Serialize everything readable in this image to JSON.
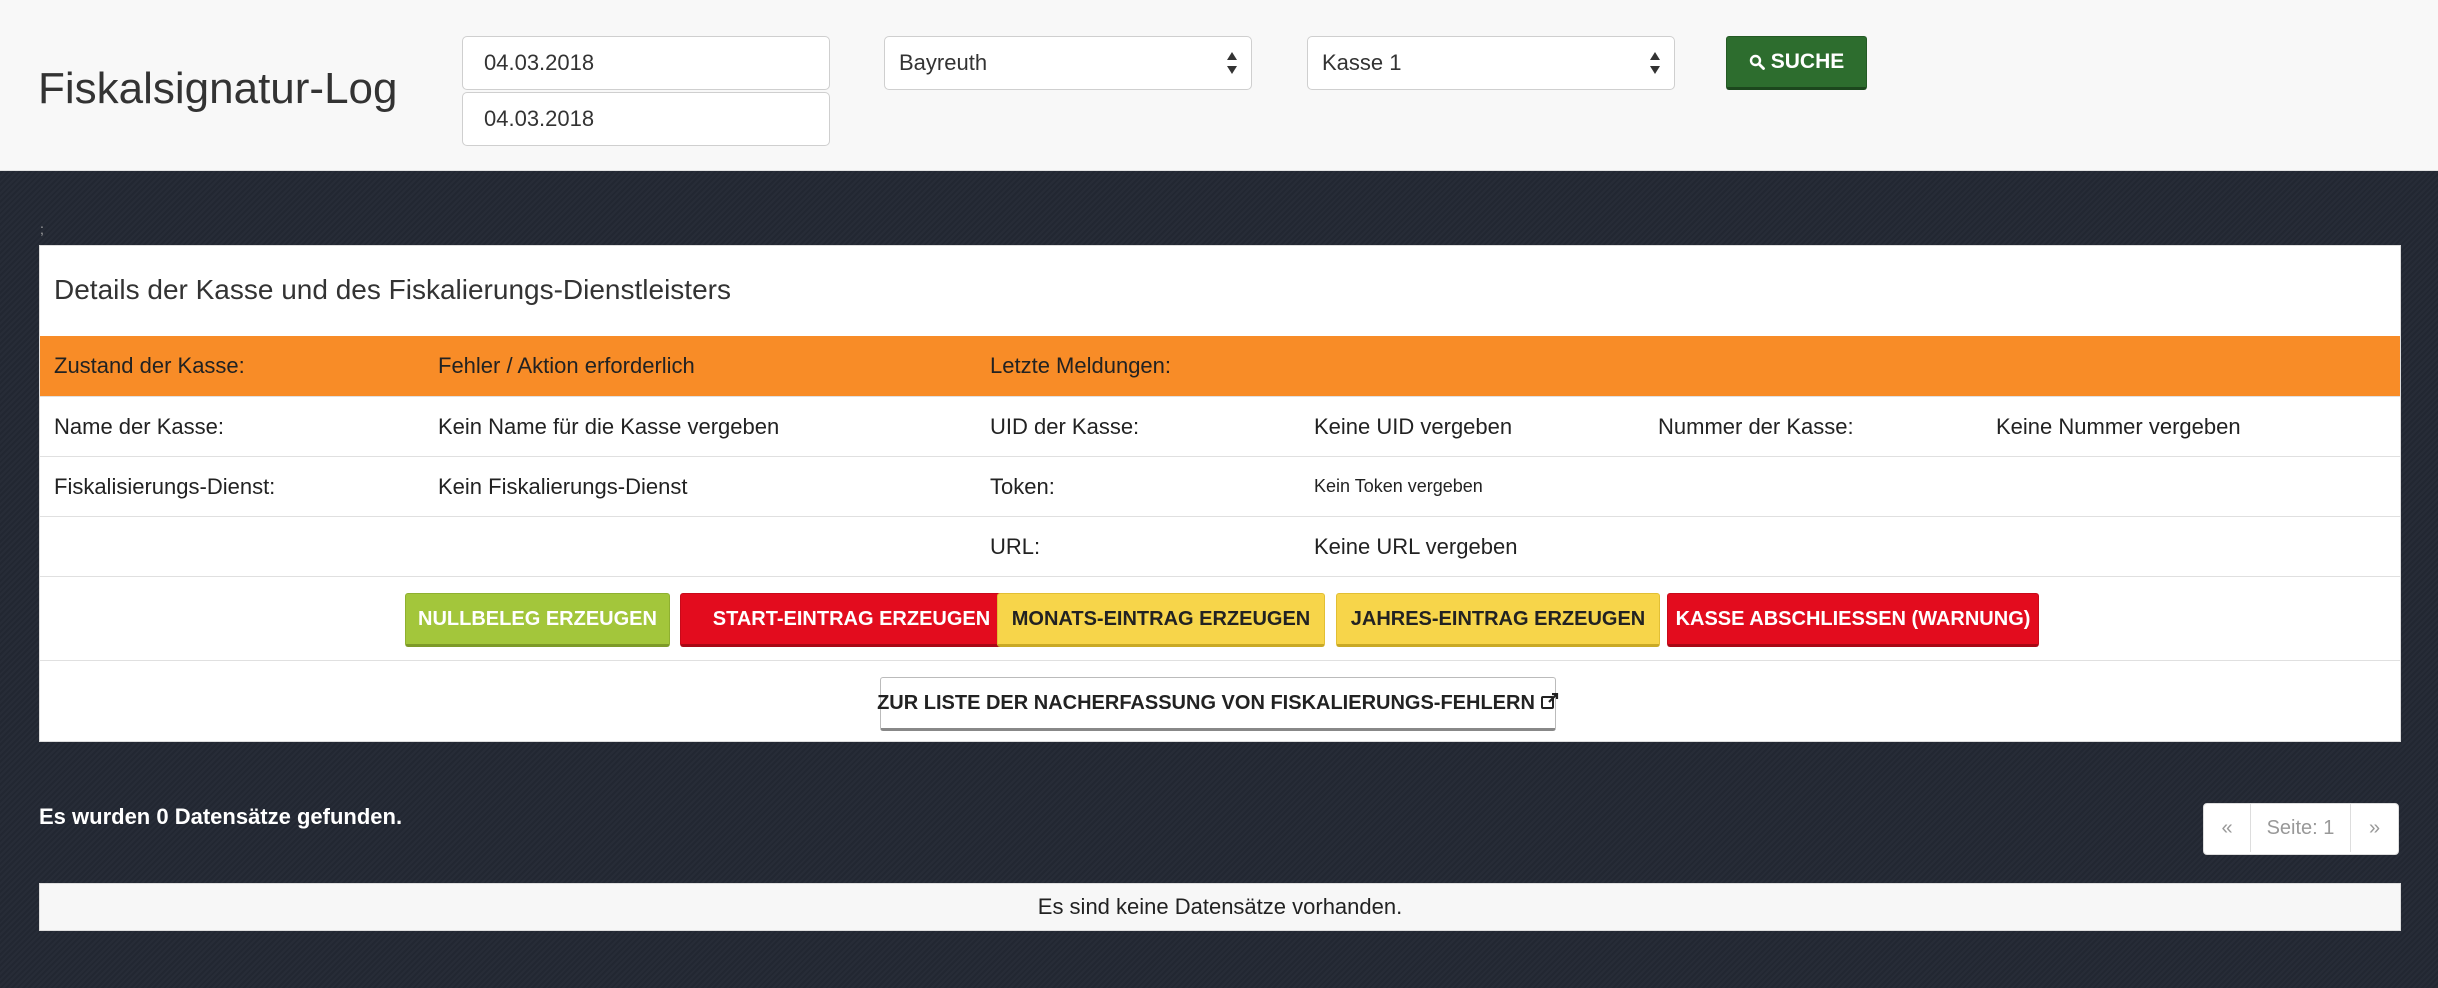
{
  "header": {
    "title": "Fiskalsignatur-Log",
    "date_from": "04.03.2018",
    "date_to": "04.03.2018",
    "location_select": "Bayreuth",
    "register_select": "Kasse 1",
    "search_label": "SUCHE",
    "search_icon": "search-icon"
  },
  "panel": {
    "title": "Details der Kasse und des Fiskalierungs-Dienstleisters",
    "status_row": {
      "label": "Zustand der Kasse:",
      "value": "Fehler / Aktion erforderlich",
      "messages_label": "Letzte Meldungen:",
      "color": "#f88c27"
    },
    "name_row": {
      "label": "Name der Kasse:",
      "value": "Kein Name für die Kasse vergeben",
      "uid_label": "UID der Kasse:",
      "uid_value": "Keine UID vergeben",
      "number_label": "Nummer der Kasse:",
      "number_value": "Keine Nummer vergeben"
    },
    "service_row": {
      "label": "Fiskalisierungs-Dienst:",
      "value": "Kein Fiskalierungs-Dienst",
      "token_label": "Token:",
      "token_value": "Kein Token vergeben"
    },
    "url_row": {
      "url_label": "URL:",
      "url_value": "Keine URL vergeben"
    },
    "actions": {
      "null_receipt": "NULLBELEG ERZEUGEN",
      "start_entry": "START-EINTRAG ERZEUGEN",
      "month_entry": "MONATS-EINTRAG ERZEUGEN",
      "year_entry": "JAHRES-EINTRAG ERZEUGEN",
      "close_register": "KASSE ABSCHLIESSEN (WARNUNG)"
    },
    "link_button": "ZUR LISTE DER NACHERFASSUNG VON FISKALIERUNGS-FEHLERN",
    "link_icon": "external-link-icon"
  },
  "results": {
    "count_text": "Es wurden 0 Datensätze gefunden.",
    "pagination": {
      "prev": "«",
      "current": "Seite: 1",
      "next": "»"
    },
    "empty_text": "Es sind keine Datensätze vorhanden."
  },
  "colors": {
    "header_bg": "#f8f8f8",
    "page_bg": "#232833",
    "search_button": "#2d6d2e",
    "green_button": "#a3c63b",
    "red_button": "#e30c1e",
    "yellow_button": "#f7d54a",
    "status_orange": "#f88c27"
  }
}
